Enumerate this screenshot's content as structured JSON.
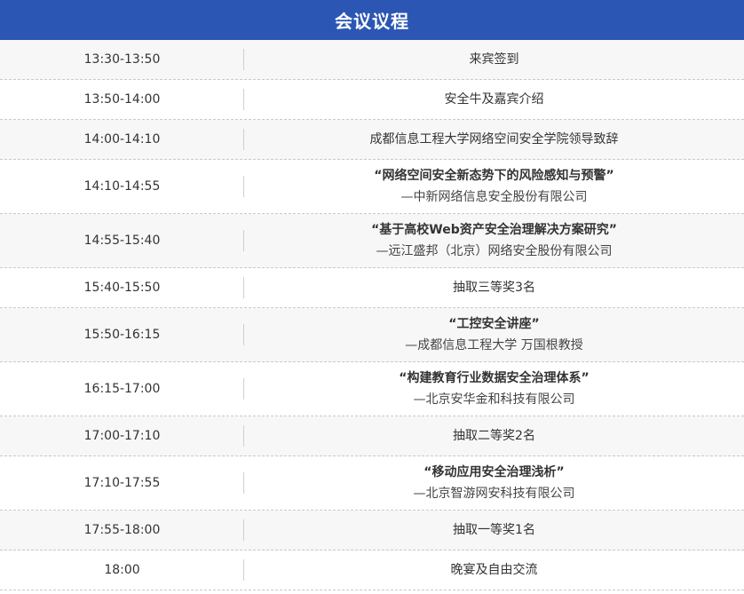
{
  "header": {
    "title": "会议议程"
  },
  "rows": [
    {
      "time": "13:30-13:50",
      "title": "来宾签到",
      "subtitle": ""
    },
    {
      "time": "13:50-14:00",
      "title": "安全牛及嘉宾介绍",
      "subtitle": ""
    },
    {
      "time": "14:00-14:10",
      "title": "成都信息工程大学网络空间安全学院领导致辞",
      "subtitle": ""
    },
    {
      "time": "14:10-14:55",
      "title": "“网络空间安全新态势下的风险感知与预警”",
      "subtitle": "—中新网络信息安全股份有限公司"
    },
    {
      "time": "14:55-15:40",
      "title": "“基于高校Web资产安全治理解决方案研究”",
      "subtitle": "—远江盛邦（北京）网络安全股份有限公司"
    },
    {
      "time": "15:40-15:50",
      "title": "抽取三等奖3名",
      "subtitle": ""
    },
    {
      "time": "15:50-16:15",
      "title": "“工控安全讲座”",
      "subtitle": "—成都信息工程大学 万国根教授"
    },
    {
      "time": "16:15-17:00",
      "title": "“构建教育行业数据安全治理体系”",
      "subtitle": "—北京安华金和科技有限公司"
    },
    {
      "time": "17:00-17:10",
      "title": "抽取二等奖2名",
      "subtitle": ""
    },
    {
      "time": "17:10-17:55",
      "title": "“移动应用安全治理浅析”",
      "subtitle": "—北京智游网安科技有限公司"
    },
    {
      "time": "17:55-18:00",
      "title": "抽取一等奖1名",
      "subtitle": ""
    },
    {
      "time": "18:00",
      "title": "晚宴及自由交流",
      "subtitle": ""
    }
  ]
}
